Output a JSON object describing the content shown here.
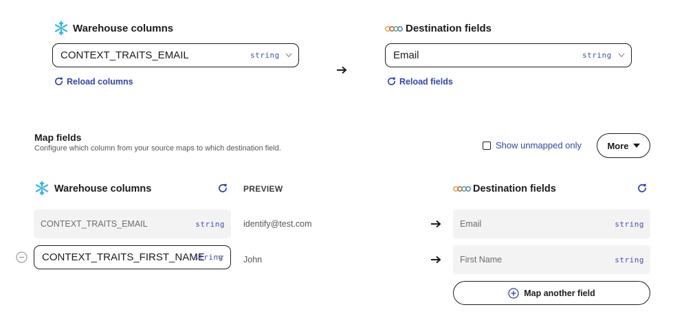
{
  "top": {
    "source": {
      "title": "Warehouse columns",
      "selected": "CONTEXT_TRAITS_EMAIL",
      "type": "string",
      "reload_label": "Reload columns"
    },
    "destination": {
      "title": "Destination fields",
      "selected": "Email",
      "type": "string",
      "reload_label": "Reload fields"
    }
  },
  "map_fields": {
    "title": "Map fields",
    "description": "Configure which column from your source maps to which destination field.",
    "show_unmapped_label": "Show unmapped only",
    "show_unmapped_checked": false,
    "more_label": "More",
    "columns": {
      "source_header": "Warehouse columns",
      "preview_header": "PREVIEW",
      "destination_header": "Destination fields"
    },
    "rows": [
      {
        "source": "CONTEXT_TRAITS_EMAIL",
        "source_type": "string",
        "preview": "identify@test.com",
        "destination": "Email",
        "destination_type": "string",
        "editable": false
      },
      {
        "source": "CONTEXT_TRAITS_FIRST_NAME",
        "source_type": "string",
        "preview": "John",
        "destination": "First Name",
        "destination_type": "string",
        "editable": true
      }
    ],
    "add_label": "Map another field"
  },
  "colors": {
    "accent": "#2e44c6",
    "snowflake": "#29b5e8",
    "field_bg": "#f3f3f3"
  },
  "icons": [
    "snowflake-logo-icon",
    "destination-logo-icon",
    "refresh-icon",
    "chevron-down-icon",
    "arrow-right-icon",
    "minus-circle-icon",
    "plus-circle-icon",
    "caret-down-icon"
  ]
}
